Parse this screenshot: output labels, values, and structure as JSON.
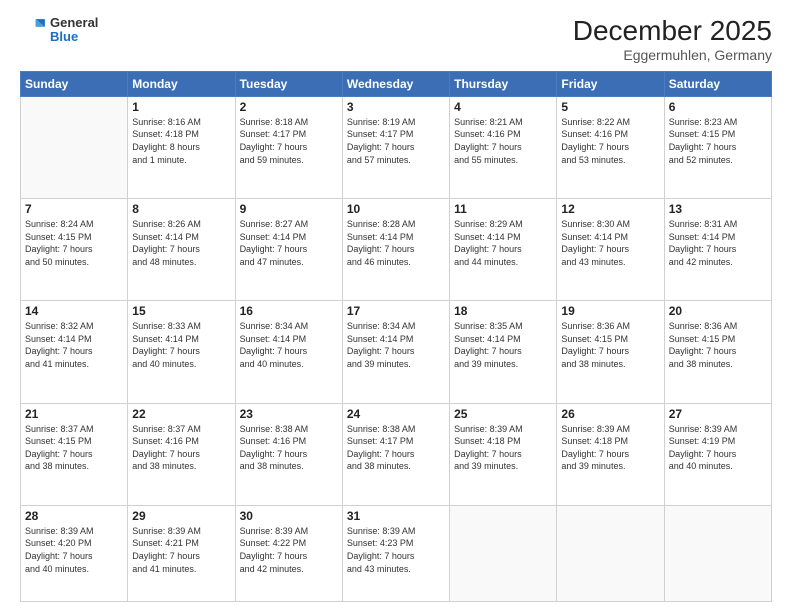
{
  "header": {
    "logo_general": "General",
    "logo_blue": "Blue",
    "title": "December 2025",
    "subtitle": "Eggermuhlen, Germany"
  },
  "days_of_week": [
    "Sunday",
    "Monday",
    "Tuesday",
    "Wednesday",
    "Thursday",
    "Friday",
    "Saturday"
  ],
  "weeks": [
    [
      {
        "day": "",
        "info": ""
      },
      {
        "day": "1",
        "info": "Sunrise: 8:16 AM\nSunset: 4:18 PM\nDaylight: 8 hours\nand 1 minute."
      },
      {
        "day": "2",
        "info": "Sunrise: 8:18 AM\nSunset: 4:17 PM\nDaylight: 7 hours\nand 59 minutes."
      },
      {
        "day": "3",
        "info": "Sunrise: 8:19 AM\nSunset: 4:17 PM\nDaylight: 7 hours\nand 57 minutes."
      },
      {
        "day": "4",
        "info": "Sunrise: 8:21 AM\nSunset: 4:16 PM\nDaylight: 7 hours\nand 55 minutes."
      },
      {
        "day": "5",
        "info": "Sunrise: 8:22 AM\nSunset: 4:16 PM\nDaylight: 7 hours\nand 53 minutes."
      },
      {
        "day": "6",
        "info": "Sunrise: 8:23 AM\nSunset: 4:15 PM\nDaylight: 7 hours\nand 52 minutes."
      }
    ],
    [
      {
        "day": "7",
        "info": "Sunrise: 8:24 AM\nSunset: 4:15 PM\nDaylight: 7 hours\nand 50 minutes."
      },
      {
        "day": "8",
        "info": "Sunrise: 8:26 AM\nSunset: 4:14 PM\nDaylight: 7 hours\nand 48 minutes."
      },
      {
        "day": "9",
        "info": "Sunrise: 8:27 AM\nSunset: 4:14 PM\nDaylight: 7 hours\nand 47 minutes."
      },
      {
        "day": "10",
        "info": "Sunrise: 8:28 AM\nSunset: 4:14 PM\nDaylight: 7 hours\nand 46 minutes."
      },
      {
        "day": "11",
        "info": "Sunrise: 8:29 AM\nSunset: 4:14 PM\nDaylight: 7 hours\nand 44 minutes."
      },
      {
        "day": "12",
        "info": "Sunrise: 8:30 AM\nSunset: 4:14 PM\nDaylight: 7 hours\nand 43 minutes."
      },
      {
        "day": "13",
        "info": "Sunrise: 8:31 AM\nSunset: 4:14 PM\nDaylight: 7 hours\nand 42 minutes."
      }
    ],
    [
      {
        "day": "14",
        "info": "Sunrise: 8:32 AM\nSunset: 4:14 PM\nDaylight: 7 hours\nand 41 minutes."
      },
      {
        "day": "15",
        "info": "Sunrise: 8:33 AM\nSunset: 4:14 PM\nDaylight: 7 hours\nand 40 minutes."
      },
      {
        "day": "16",
        "info": "Sunrise: 8:34 AM\nSunset: 4:14 PM\nDaylight: 7 hours\nand 40 minutes."
      },
      {
        "day": "17",
        "info": "Sunrise: 8:34 AM\nSunset: 4:14 PM\nDaylight: 7 hours\nand 39 minutes."
      },
      {
        "day": "18",
        "info": "Sunrise: 8:35 AM\nSunset: 4:14 PM\nDaylight: 7 hours\nand 39 minutes."
      },
      {
        "day": "19",
        "info": "Sunrise: 8:36 AM\nSunset: 4:15 PM\nDaylight: 7 hours\nand 38 minutes."
      },
      {
        "day": "20",
        "info": "Sunrise: 8:36 AM\nSunset: 4:15 PM\nDaylight: 7 hours\nand 38 minutes."
      }
    ],
    [
      {
        "day": "21",
        "info": "Sunrise: 8:37 AM\nSunset: 4:15 PM\nDaylight: 7 hours\nand 38 minutes."
      },
      {
        "day": "22",
        "info": "Sunrise: 8:37 AM\nSunset: 4:16 PM\nDaylight: 7 hours\nand 38 minutes."
      },
      {
        "day": "23",
        "info": "Sunrise: 8:38 AM\nSunset: 4:16 PM\nDaylight: 7 hours\nand 38 minutes."
      },
      {
        "day": "24",
        "info": "Sunrise: 8:38 AM\nSunset: 4:17 PM\nDaylight: 7 hours\nand 38 minutes."
      },
      {
        "day": "25",
        "info": "Sunrise: 8:39 AM\nSunset: 4:18 PM\nDaylight: 7 hours\nand 39 minutes."
      },
      {
        "day": "26",
        "info": "Sunrise: 8:39 AM\nSunset: 4:18 PM\nDaylight: 7 hours\nand 39 minutes."
      },
      {
        "day": "27",
        "info": "Sunrise: 8:39 AM\nSunset: 4:19 PM\nDaylight: 7 hours\nand 40 minutes."
      }
    ],
    [
      {
        "day": "28",
        "info": "Sunrise: 8:39 AM\nSunset: 4:20 PM\nDaylight: 7 hours\nand 40 minutes."
      },
      {
        "day": "29",
        "info": "Sunrise: 8:39 AM\nSunset: 4:21 PM\nDaylight: 7 hours\nand 41 minutes."
      },
      {
        "day": "30",
        "info": "Sunrise: 8:39 AM\nSunset: 4:22 PM\nDaylight: 7 hours\nand 42 minutes."
      },
      {
        "day": "31",
        "info": "Sunrise: 8:39 AM\nSunset: 4:23 PM\nDaylight: 7 hours\nand 43 minutes."
      },
      {
        "day": "",
        "info": ""
      },
      {
        "day": "",
        "info": ""
      },
      {
        "day": "",
        "info": ""
      }
    ]
  ]
}
